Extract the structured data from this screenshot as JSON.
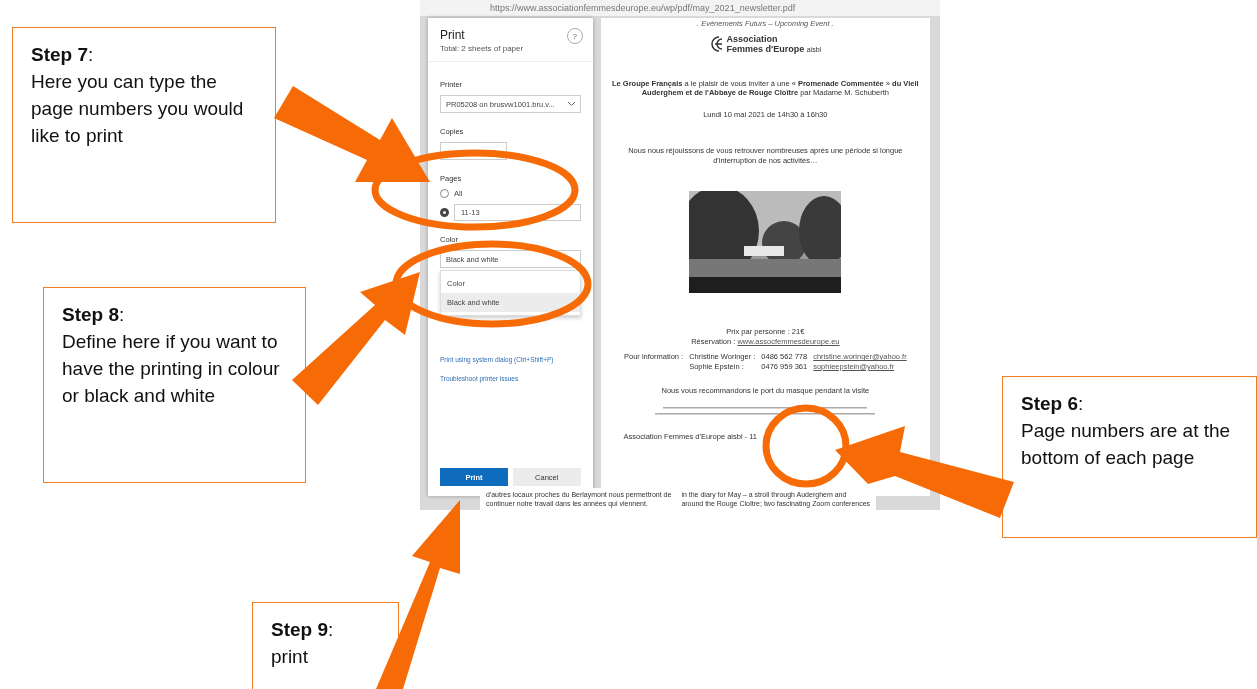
{
  "browser": {
    "address": "https://www.associationfemmesdeurope.eu/wp/pdf/may_2021_newsletter.pdf"
  },
  "dialog": {
    "title": "Print",
    "subtitle": "Total: 2 sheets of paper",
    "help": "?",
    "printer": {
      "label": "Printer",
      "value": "PR05208 on brusvw1001.bru.v..."
    },
    "copies": {
      "label": "Copies"
    },
    "pages": {
      "label": "Pages",
      "options": [
        {
          "label": "All",
          "selected": false
        },
        {
          "value": "11-13",
          "selected": true
        }
      ]
    },
    "color": {
      "label": "Color",
      "value": "Black and white",
      "expanded": true,
      "options": [
        {
          "label": "Color",
          "selected": false
        },
        {
          "label": "Black and white",
          "selected": true
        }
      ]
    },
    "links": [
      "Print using system dialog (Ctrl+Shift+P)",
      "Troubleshoot printer issues"
    ],
    "buttons": [
      {
        "label": "Print",
        "kind": "primary"
      },
      {
        "label": "Cancel",
        "kind": "secondary"
      }
    ]
  },
  "preview": {
    "header": ". Evénements Futurs – Upcoming Event .",
    "logo": [
      "Association",
      "Femmes d'Europe"
    ],
    "logo_suffix": "aisbl",
    "invite": "**Le Groupe Français** a le plaisir de vous inviter à une « **Promenade Commentée** » **du Vieil Auderghem et de l'Abbaye de Rouge Cloître** par Madame M. Schuberth",
    "date": "Lundi 10 mai 2021 de 14h30 à 16h30",
    "intro": "Nous nous réjouissons de vous retrouver nombreuses après une période si longue d'interruption de nos activités…",
    "price": "Prix par personne :  21€",
    "reservation_label": "Réservation :",
    "reservation_link": "www.assocfemmesdeurope.eu",
    "info_label": "Pour information :",
    "contacts": [
      {
        "name": "Christine Woringer :",
        "phone": "0486 562 778",
        "email": "christine.woringer@yahoo.fr"
      },
      {
        "name": "Sophie Epstein :",
        "phone": "0476 959 361",
        "email": "sophieepstein@yahoo.fr"
      }
    ],
    "mask": "Nous vous recommandons le port du masque pendant la visite",
    "footer": "Association Femmes d'Europe aisbl - 11"
  },
  "background_text": {
    "left": [
      "d'autres locaux proches du Berlaymont nous permettront de",
      "continuer notre travail dans les années qui viennent."
    ],
    "right": [
      "in the diary for May – a stroll through Auderghem and",
      "around the Rouge Cloître; two fascinating Zoom conferences"
    ]
  },
  "callouts": [
    {
      "step": "**Step 7**:",
      "text": "Here you can type the page numbers you would like to print",
      "kind": "a"
    },
    {
      "step": "**Step 8**:",
      "text": "Define here if you want to have the printing in colour or black and white",
      "kind": "b"
    },
    {
      "step": "**Step 6**:",
      "text": "Page numbers are at the bottom of each page",
      "kind": "c"
    },
    {
      "step": "**Step 9**:",
      "text": "print",
      "kind": "d"
    }
  ]
}
